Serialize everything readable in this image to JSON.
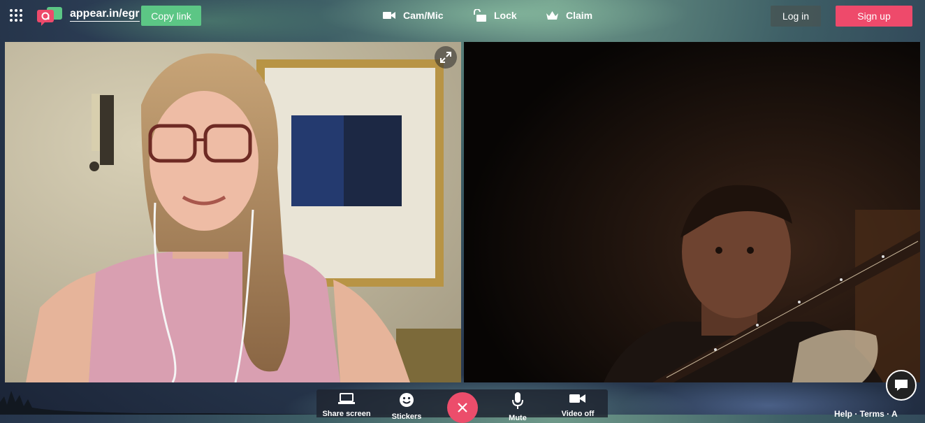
{
  "header": {
    "room_url": "appear.in/egr",
    "copy_link_label": "Copy link",
    "cam_mic_label": "Cam/Mic",
    "lock_label": "Lock",
    "claim_label": "Claim",
    "login_label": "Log in",
    "signup_label": "Sign up"
  },
  "colors": {
    "copy_button": "#5cc685",
    "signup_button": "#ee4a6b",
    "hangup_button": "#ec4d6b"
  },
  "controls": {
    "share_screen_label": "Share screen",
    "stickers_label": "Stickers",
    "mute_label": "Mute",
    "video_off_label": "Video off"
  },
  "footer": {
    "text": "Help · Terms · A"
  },
  "icons": [
    "apps-grid-icon",
    "appear-in-logo",
    "camera-icon",
    "lock-icon",
    "crown-icon",
    "expand-icon",
    "laptop-icon",
    "smiley-icon",
    "close-icon",
    "microphone-icon",
    "video-camera-icon",
    "chat-bubble-icon"
  ]
}
